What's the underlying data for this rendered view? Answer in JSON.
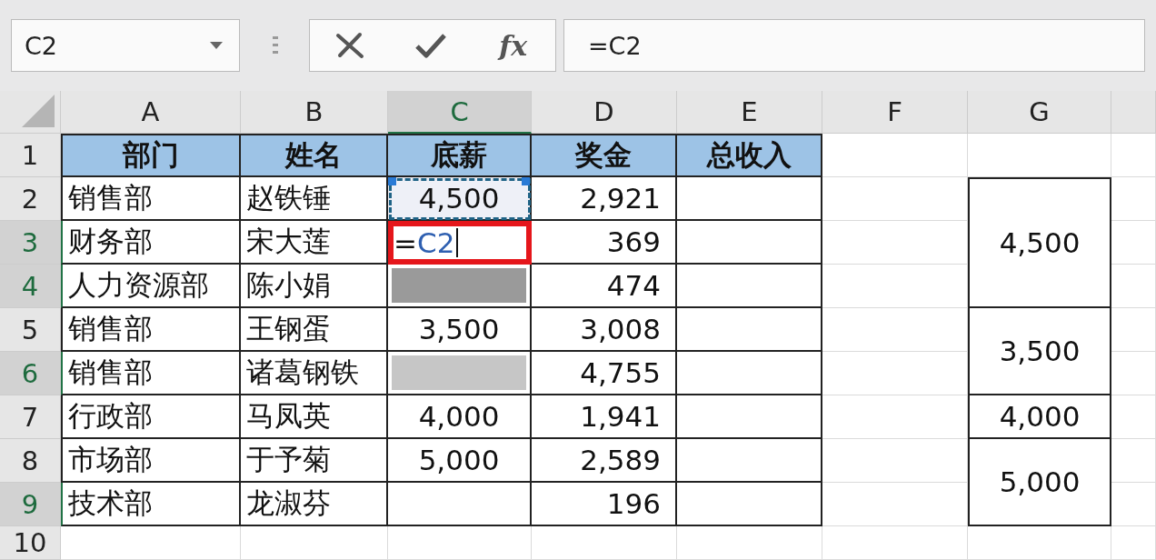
{
  "name_box": {
    "value": "C2"
  },
  "formula_bar": {
    "function_button": "fx",
    "value": "=C2"
  },
  "columns": [
    {
      "label": "A",
      "selected": false
    },
    {
      "label": "B",
      "selected": false
    },
    {
      "label": "C",
      "selected": true
    },
    {
      "label": "D",
      "selected": false
    },
    {
      "label": "E",
      "selected": false
    },
    {
      "label": "F",
      "selected": false
    },
    {
      "label": "G",
      "selected": false
    }
  ],
  "header_row": {
    "number": "1",
    "selected": false,
    "cells": [
      "部门",
      "姓名",
      "底薪",
      "奖金",
      "总收入"
    ]
  },
  "rows": [
    {
      "number": "2",
      "selected": false,
      "dept": "销售部",
      "name": "赵铁锤",
      "base": {
        "kind": "copy-source",
        "text": "4,500"
      },
      "bonus": "2,921"
    },
    {
      "number": "3",
      "selected": true,
      "dept": "财务部",
      "name": "宋大莲",
      "base": {
        "kind": "editing",
        "prefix": "=",
        "reference": "C2"
      },
      "bonus": "369"
    },
    {
      "number": "4",
      "selected": true,
      "dept": "人力资源部",
      "name": "陈小娟",
      "base": {
        "kind": "selected-dark"
      },
      "bonus": "474"
    },
    {
      "number": "5",
      "selected": false,
      "dept": "销售部",
      "name": "王钢蛋",
      "base": {
        "kind": "value",
        "text": "3,500"
      },
      "bonus": "3,008"
    },
    {
      "number": "6",
      "selected": true,
      "dept": "销售部",
      "name": "诸葛钢铁",
      "base": {
        "kind": "selected-light"
      },
      "bonus": "4,755"
    },
    {
      "number": "7",
      "selected": false,
      "dept": "行政部",
      "name": "马凤英",
      "base": {
        "kind": "value",
        "text": "4,000"
      },
      "bonus": "1,941"
    },
    {
      "number": "8",
      "selected": false,
      "dept": "市场部",
      "name": "于予菊",
      "base": {
        "kind": "value",
        "text": "5,000"
      },
      "bonus": "2,589"
    },
    {
      "number": "9",
      "selected": true,
      "dept": "技术部",
      "name": "龙淑芬",
      "base": {
        "kind": "selected-white"
      },
      "bonus": "196"
    }
  ],
  "last_row": {
    "number": "10",
    "selected": false
  },
  "summary_cells": [
    "4,500",
    "3,500",
    "4,000",
    "5,000"
  ]
}
